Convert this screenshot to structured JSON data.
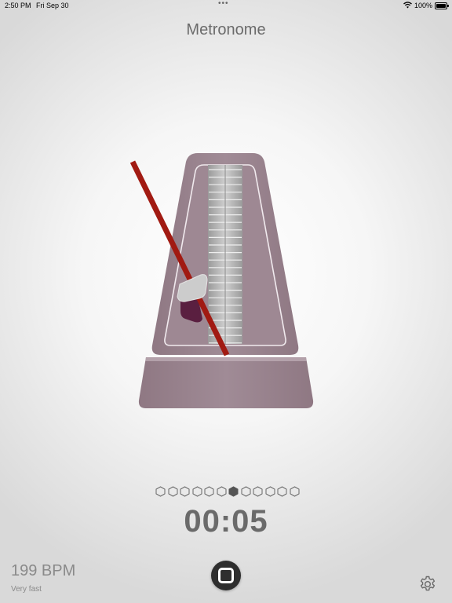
{
  "status_bar": {
    "time": "2:50 PM",
    "date": "Fri Sep 30",
    "dots": "•••",
    "battery_pct": "100%"
  },
  "title": "Metronome",
  "beats": {
    "count": 12,
    "active_index": 6
  },
  "timer": "00:05",
  "bpm_label": "199 BPM",
  "tempo_name": "Very fast",
  "colors": {
    "body": "#9b8590",
    "pendulum": "#a11a12",
    "weight": "#c8c8c8",
    "scale": "#b5b5b5"
  },
  "icons": {
    "wifi": "wifi-icon",
    "battery": "battery-icon",
    "stop": "stop-icon",
    "settings": "gear-icon"
  }
}
